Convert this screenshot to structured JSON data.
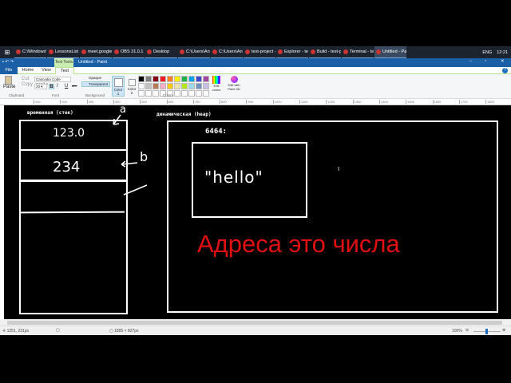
{
  "taskbar": {
    "items": [
      "C:\\Windows\\S...",
      "LessonsList - ...",
      "meet.google....",
      "OBS 31.0.1 - ...",
      "Desktop",
      "C:\\Users\\Ant...",
      "C:\\Users\\Ant...",
      "test-project -...",
      "Explorer - tes...",
      "Build - test-p...",
      "Terminal - tes...",
      "Untitled - Paint"
    ],
    "lang": "ENG",
    "time": "12:21"
  },
  "title": {
    "context_tab": "Text Tools",
    "window_title": "Untitled - Paint"
  },
  "tabs": [
    "File",
    "Home",
    "View",
    "Text"
  ],
  "ribbon": {
    "paste": "Paste",
    "cut": "Cut",
    "copy": "Copy",
    "font_name": "Cascadia Code Semil",
    "font_size": "20",
    "bold": "B",
    "italic": "I",
    "underline": "U",
    "strike": "abc",
    "opaque": "Opaque",
    "transparent": "Transparent",
    "color1": "Color 1",
    "color2": "Color 2",
    "edit_colors": "Edit colors",
    "edit_paint3d": "Edit with Paint 3D",
    "groups": {
      "clipboard": "Clipboard",
      "font": "Font",
      "background": "Background",
      "colors": "Colors"
    },
    "palette": [
      "#000000",
      "#7f7f7f",
      "#880015",
      "#ed1c24",
      "#ff7f27",
      "#fff200",
      "#22b14c",
      "#00a2e8",
      "#3f48cc",
      "#a349a4",
      "#ffffff",
      "#c3c3c3",
      "#b97a57",
      "#ffaec9",
      "#ffc90e",
      "#efe4b0",
      "#b5e61d",
      "#99d9ea",
      "#7092be",
      "#c8bfe7"
    ]
  },
  "ruler": [
    "100",
    "200",
    "300",
    "400",
    "500",
    "600",
    "700",
    "800",
    "900",
    "1000",
    "1100",
    "1200",
    "1300",
    "1400",
    "1500",
    "1600",
    "1700",
    "1800"
  ],
  "canvas": {
    "stack_label": "временная (стек)",
    "heap_label": "динамическая (heap)",
    "cell1": "123.0",
    "cell2": "234",
    "label_a": "a",
    "label_b": "b",
    "address": "6464:",
    "heap_value": "\"hello\"",
    "caption": "Адреса это числа",
    "caption_color": "#e01010"
  },
  "status": {
    "cursor": "1251, 231px",
    "size": "1895 × 827px",
    "zoom": "100%"
  }
}
